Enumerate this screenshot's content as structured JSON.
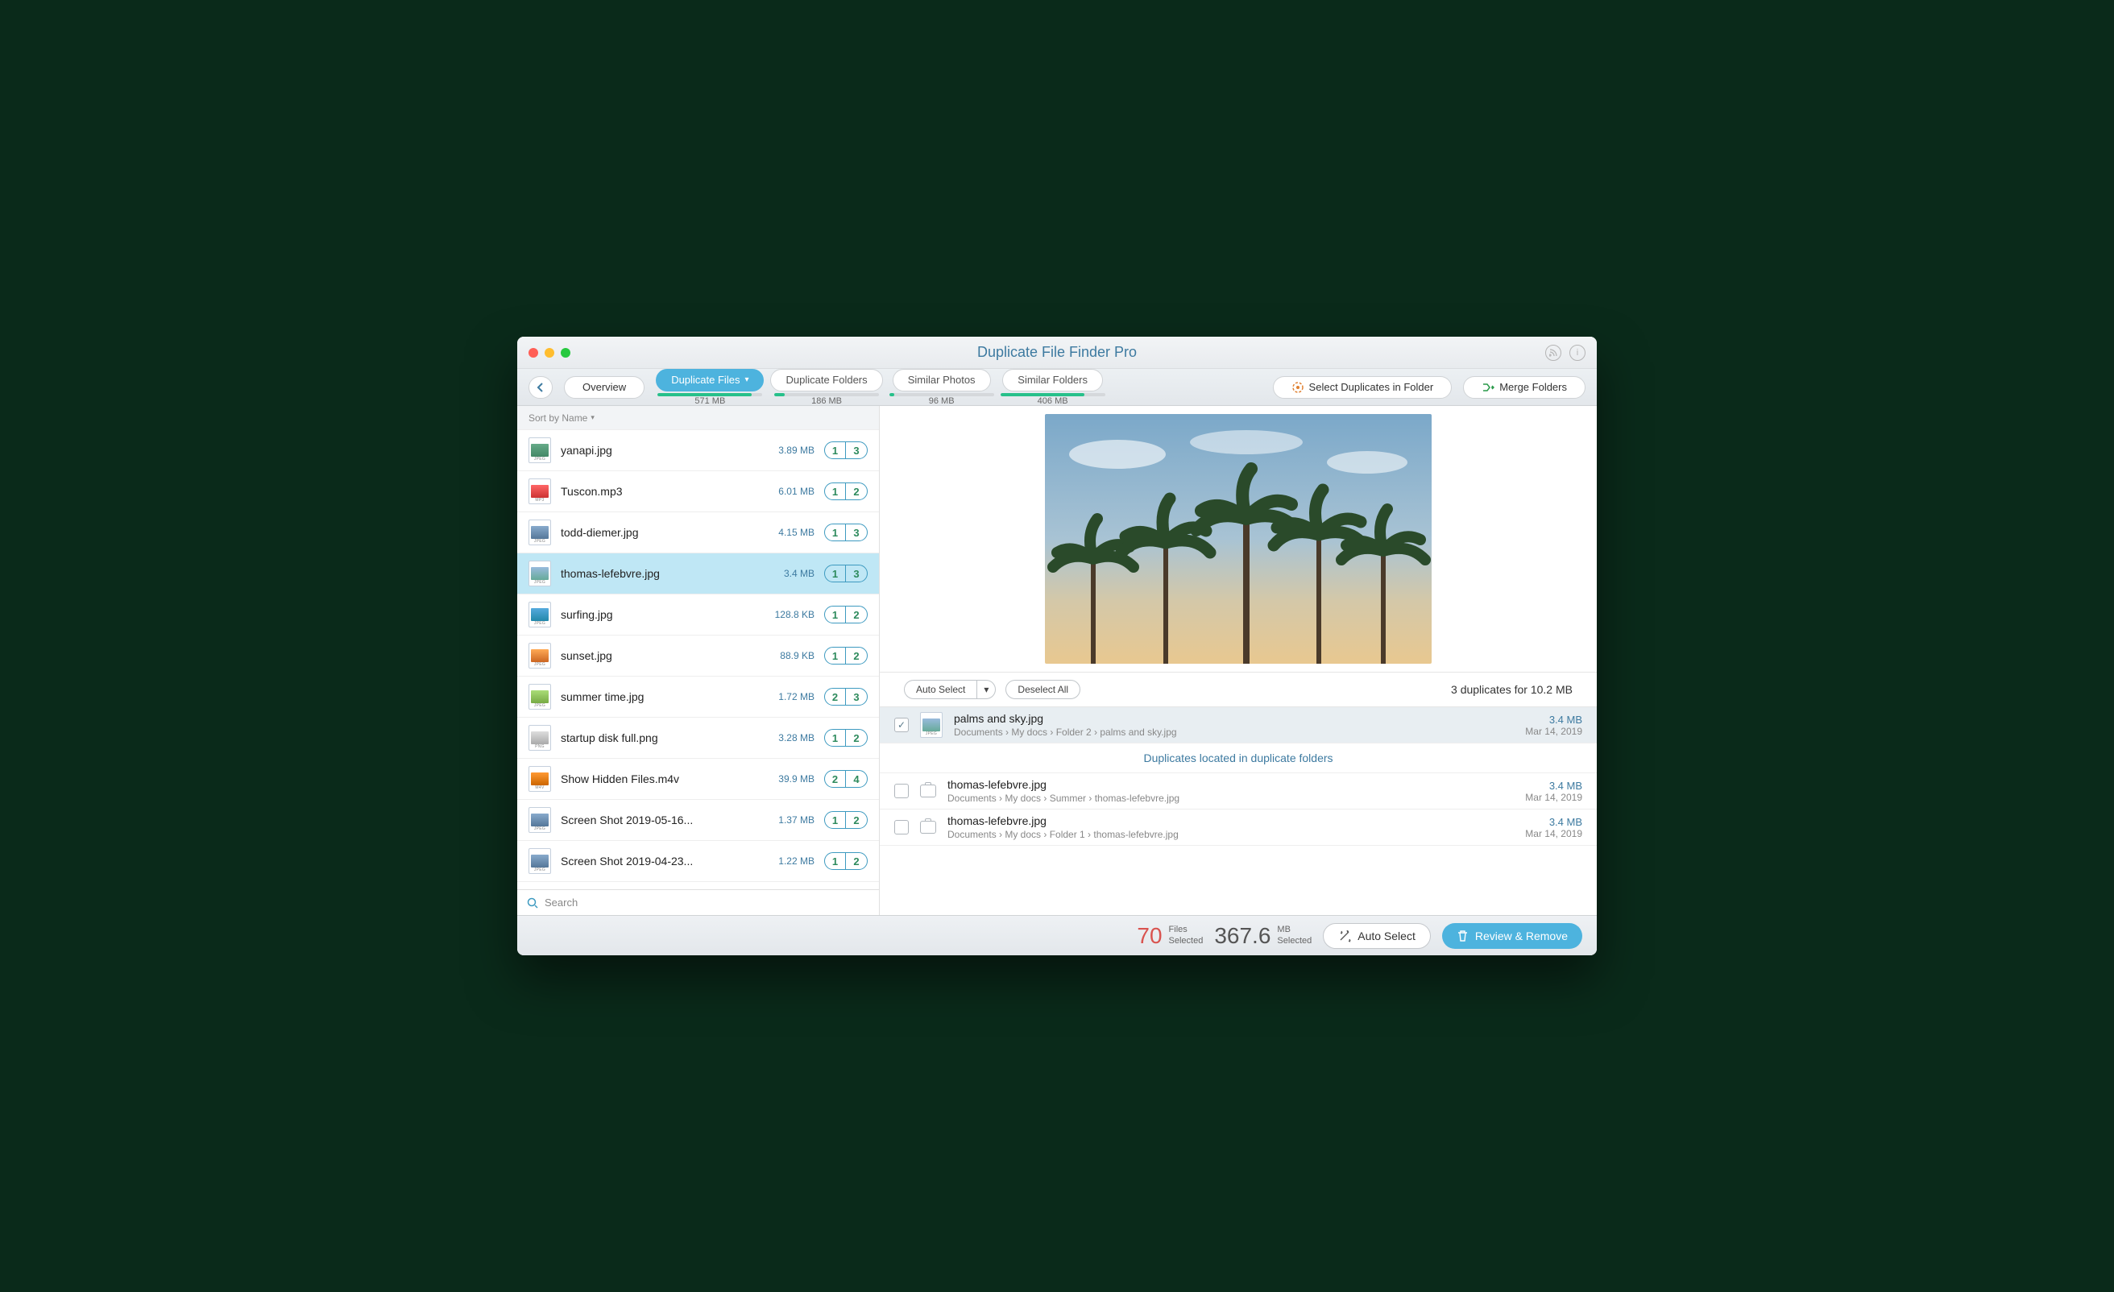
{
  "title": "Duplicate File Finder Pro",
  "toolbar": {
    "overview": "Overview",
    "select_dup": "Select Duplicates in Folder",
    "merge": "Merge Folders"
  },
  "tabs": [
    {
      "label": "Duplicate Files",
      "size": "571 MB",
      "active": true,
      "fill": 90,
      "color": "#27c08a"
    },
    {
      "label": "Duplicate Folders",
      "size": "186 MB",
      "active": false,
      "fill": 10,
      "color": "#27c08a"
    },
    {
      "label": "Similar Photos",
      "size": "96 MB",
      "active": false,
      "fill": 5,
      "color": "#27c08a"
    },
    {
      "label": "Similar Folders",
      "size": "406 MB",
      "active": false,
      "fill": 80,
      "color": "#27c08a"
    }
  ],
  "sort_label": "Sort by Name",
  "files": [
    {
      "name": "yanapi.jpg",
      "size": "3.89 MB",
      "a": "1",
      "b": "3",
      "ext": "JPEG",
      "thumb": "linear-gradient(#6a8,#486)"
    },
    {
      "name": "Tuscon.mp3",
      "size": "6.01 MB",
      "a": "1",
      "b": "2",
      "ext": "MP3",
      "thumb": "linear-gradient(#f66,#c33)"
    },
    {
      "name": "todd-diemer.jpg",
      "size": "4.15 MB",
      "a": "1",
      "b": "3",
      "ext": "JPEG",
      "thumb": "linear-gradient(#8ac,#579)"
    },
    {
      "name": "thomas-lefebvre.jpg",
      "size": "3.4 MB",
      "a": "1",
      "b": "3",
      "ext": "JPEG",
      "thumb": "linear-gradient(#9bd,#6a9)",
      "selected": true
    },
    {
      "name": "surfing.jpg",
      "size": "128.8 KB",
      "a": "1",
      "b": "2",
      "ext": "JPEG",
      "thumb": "linear-gradient(#5ad,#28a)"
    },
    {
      "name": "sunset.jpg",
      "size": "88.9 KB",
      "a": "1",
      "b": "2",
      "ext": "JPEG",
      "thumb": "linear-gradient(#fa5,#c62)"
    },
    {
      "name": "summer time.jpg",
      "size": "1.72 MB",
      "a": "2",
      "b": "3",
      "ext": "JPEG",
      "thumb": "linear-gradient(#ad7,#7a4)"
    },
    {
      "name": "startup disk full.png",
      "size": "3.28 MB",
      "a": "1",
      "b": "2",
      "ext": "PNG",
      "thumb": "linear-gradient(#ddd,#aaa)"
    },
    {
      "name": "Show Hidden Files.m4v",
      "size": "39.9 MB",
      "a": "2",
      "b": "4",
      "ext": "M4V",
      "thumb": "linear-gradient(#f93,#c60)"
    },
    {
      "name": "Screen Shot 2019-05-16...",
      "size": "1.37 MB",
      "a": "1",
      "b": "2",
      "ext": "JPEG",
      "thumb": "linear-gradient(#8ac,#579)"
    },
    {
      "name": "Screen Shot 2019-04-23...",
      "size": "1.22 MB",
      "a": "1",
      "b": "2",
      "ext": "JPEG",
      "thumb": "linear-gradient(#8ac,#579)"
    }
  ],
  "search_placeholder": "Search",
  "actions": {
    "auto_select": "Auto Select",
    "deselect": "Deselect All"
  },
  "dup_summary": "3 duplicates for 10.2 MB",
  "divider_text": "Duplicates located in duplicate folders",
  "duplicates": [
    {
      "name": "palms and sky.jpg",
      "path": "Documents  ›  My docs  ›  Folder 2  ›  palms and sky.jpg",
      "size": "3.4 MB",
      "date": "Mar 14, 2019",
      "checked": true,
      "selected": true,
      "icon": "file"
    },
    {
      "name": "thomas-lefebvre.jpg",
      "path": "Documents  ›  My docs  ›  Summer  ›  thomas-lefebvre.jpg",
      "size": "3.4 MB",
      "date": "Mar 14, 2019",
      "checked": false,
      "icon": "camera"
    },
    {
      "name": "thomas-lefebvre.jpg",
      "path": "Documents  ›  My docs  ›  Folder 1  ›  thomas-lefebvre.jpg",
      "size": "3.4 MB",
      "date": "Mar 14, 2019",
      "checked": false,
      "icon": "camera"
    }
  ],
  "footer": {
    "files_count": "70",
    "files_label1": "Files",
    "files_label2": "Selected",
    "mb_count": "367.6",
    "mb_label1": "MB",
    "mb_label2": "Selected",
    "auto_select": "Auto Select",
    "review": "Review & Remove"
  }
}
